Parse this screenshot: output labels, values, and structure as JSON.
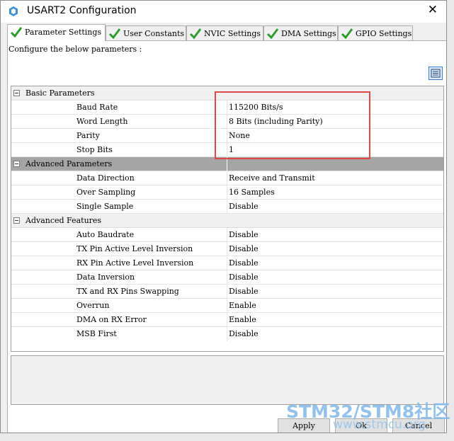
{
  "window": {
    "title": "USART2 Configuration",
    "close_glyph": "✕"
  },
  "tabs": [
    {
      "label": "Parameter Settings",
      "active": true
    },
    {
      "label": "User Constants",
      "active": false
    },
    {
      "label": "NVIC Settings",
      "active": false
    },
    {
      "label": "DMA Settings",
      "active": false
    },
    {
      "label": "GPIO Settings",
      "active": false
    }
  ],
  "panel": {
    "description": "Configure the below parameters :"
  },
  "groups": {
    "basic": {
      "label": "Basic Parameters",
      "rows": [
        {
          "name": "Baud Rate",
          "value": "115200 Bits/s"
        },
        {
          "name": "Word Length",
          "value": "8 Bits (including Parity)"
        },
        {
          "name": "Parity",
          "value": "None"
        },
        {
          "name": "Stop Bits",
          "value": "1"
        }
      ]
    },
    "advanced": {
      "label": "Advanced Parameters",
      "rows": [
        {
          "name": "Data Direction",
          "value": "Receive and Transmit"
        },
        {
          "name": "Over Sampling",
          "value": "16 Samples"
        },
        {
          "name": "Single Sample",
          "value": "Disable"
        }
      ]
    },
    "features": {
      "label": "Advanced Features",
      "rows": [
        {
          "name": "Auto Baudrate",
          "value": "Disable"
        },
        {
          "name": "TX Pin Active Level Inversion",
          "value": "Disable"
        },
        {
          "name": "RX Pin Active Level Inversion",
          "value": "Disable"
        },
        {
          "name": "Data Inversion",
          "value": "Disable"
        },
        {
          "name": "TX and RX Pins Swapping",
          "value": "Disable"
        },
        {
          "name": "Overrun",
          "value": "Enable"
        },
        {
          "name": "DMA on RX Error",
          "value": "Enable"
        },
        {
          "name": "MSB First",
          "value": "Disable"
        }
      ]
    }
  },
  "buttons": {
    "apply": "Apply",
    "ok": "Ok",
    "cancel": "Cancel"
  },
  "watermark": {
    "brand": "STM32/STM8社区",
    "url": "www.stmcu.org"
  },
  "colors": {
    "accent": "#2e9b2e",
    "highlight_box": "#e04848",
    "selected_group": "#a5a5a5"
  }
}
